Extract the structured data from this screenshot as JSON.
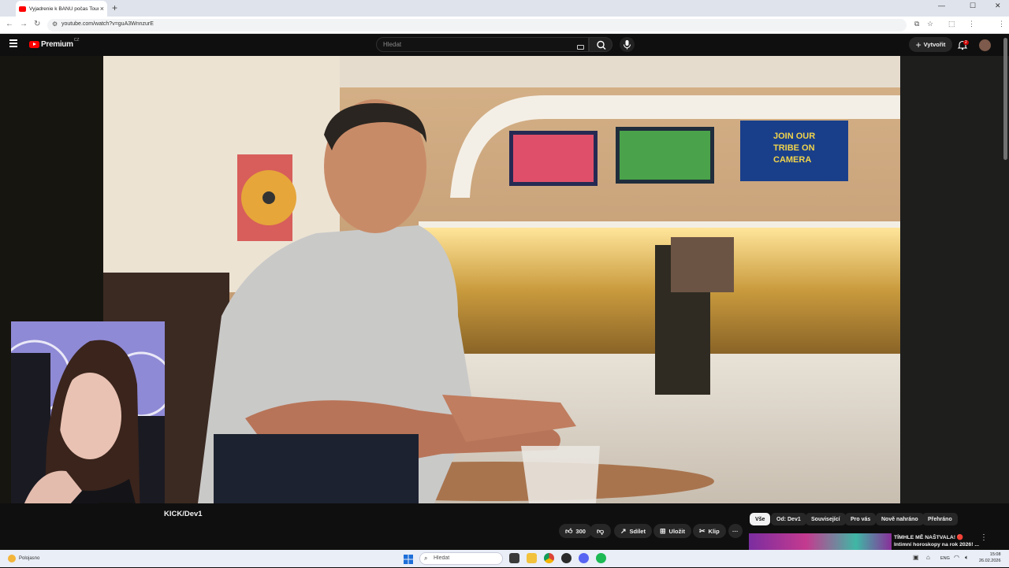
{
  "browser": {
    "tab_title": "Vyjadrenie k BANU počas Tour...",
    "url": "youtube.com/watch?v=guA3WnnzurE",
    "new_tab_label": "+",
    "close_tab_label": "×"
  },
  "youtube": {
    "logo_text": "Premium",
    "country_code": "CZ",
    "search_placeholder": "Hledat",
    "create_label": "Vytvořit",
    "notification_count": "2",
    "channel_name": "KICK/Dev1",
    "actions": {
      "like_count": "300",
      "share_label": "Sdílet",
      "save_label": "Uložit",
      "clip_label": "Klip",
      "more_label": "···"
    },
    "chips": [
      "Vše",
      "Od: Dev1",
      "Související",
      "Pro vás",
      "Nově nahráno",
      "Přehráno"
    ],
    "recommendation": {
      "title_line1": "TÍMHLE MĚ NAŠTVALA! 🔴",
      "title_line2": "Intimní horoskopy na rok 2026! ..."
    }
  },
  "taskbar": {
    "status_text": "Polojasno",
    "search_placeholder": "Hledat",
    "language": "ENG",
    "time": "15:08",
    "date": "26.02.2026"
  }
}
